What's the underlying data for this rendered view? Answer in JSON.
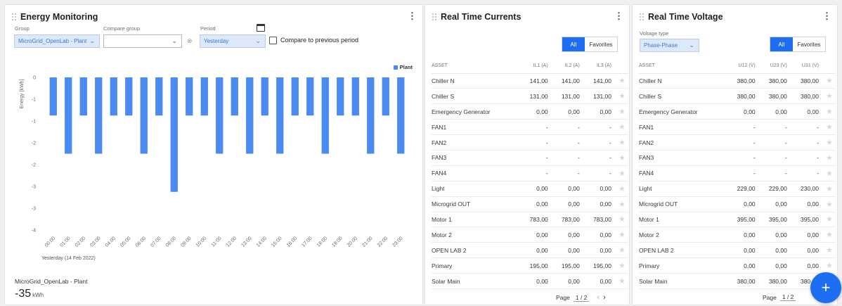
{
  "energy": {
    "title": "Energy Monitoring",
    "group_label": "Group",
    "group_value": "MicroGrid_OpenLab - Plant",
    "compare_label": "Compare group",
    "compare_value": "",
    "period_label": "Period",
    "period_value": "Yesterday",
    "compare_prev_label": "Compare to previous period",
    "x_sublabel": "Yesterday (14 Feb 2022)",
    "summary_name": "MicroGrid_OpenLab - Plant",
    "summary_value": "-35",
    "summary_unit": "kWh"
  },
  "chart_data": {
    "type": "bar",
    "categories": [
      "00:00",
      "01:00",
      "02:00",
      "03:00",
      "04:00",
      "05:00",
      "06:00",
      "07:00",
      "08:00",
      "09:00",
      "10:00",
      "11:00",
      "12:00",
      "13:00",
      "14:00",
      "15:00",
      "16:00",
      "17:00",
      "18:00",
      "19:00",
      "20:00",
      "21:00",
      "22:00",
      "23:00"
    ],
    "series": [
      {
        "name": "Plant",
        "values": [
          -1,
          -2,
          -1,
          -2,
          -1,
          -1,
          -2,
          -1,
          -3,
          -1,
          -1,
          -2,
          -1,
          -2,
          -1,
          -2,
          -1,
          -1,
          -2,
          -1,
          -1,
          -2,
          -1,
          -2
        ]
      }
    ],
    "ylabel": "Energy [kWh]",
    "ylim": [
      -4,
      0
    ],
    "yticks": [
      "0",
      "-1",
      "-1",
      "-2",
      "-2",
      "-3",
      "-3",
      "-4"
    ],
    "color": "#4b8bf0",
    "legend_position": "top-right",
    "grid": false
  },
  "currents": {
    "title": "Real Time Currents",
    "seg_all": "All",
    "seg_fav": "Favorites",
    "headers": [
      "ASSET",
      "IL1 (A)",
      "IL2 (A)",
      "IL3 (A)"
    ],
    "rows": [
      [
        "Chiller N",
        "141,00",
        "141,00",
        "141,00"
      ],
      [
        "Chiller S",
        "131,00",
        "131,00",
        "131,00"
      ],
      [
        "Emergency Generator",
        "0,00",
        "0,00",
        "0,00"
      ],
      [
        "FAN1",
        "-",
        "-",
        "-"
      ],
      [
        "FAN2",
        "-",
        "-",
        "-"
      ],
      [
        "FAN3",
        "-",
        "-",
        "-"
      ],
      [
        "FAN4",
        "-",
        "-",
        "-"
      ],
      [
        "Light",
        "0,00",
        "0,00",
        "0,00"
      ],
      [
        "Microgrid OUT",
        "0,00",
        "0,00",
        "0,00"
      ],
      [
        "Motor 1",
        "783,00",
        "783,00",
        "783,00"
      ],
      [
        "Motor 2",
        "0,00",
        "0,00",
        "0,00"
      ],
      [
        "OPEN LAB 2",
        "0,00",
        "0,00",
        "0,00"
      ],
      [
        "Primary",
        "195,00",
        "195,00",
        "195,00"
      ],
      [
        "Solar Main",
        "0,00",
        "0,00",
        "0,00"
      ]
    ],
    "page_label": "Page",
    "page_value": "1 / 2"
  },
  "voltage": {
    "title": "Real Time Voltage",
    "type_label": "Voltage type",
    "type_value": "Phase-Phase",
    "seg_all": "All",
    "seg_fav": "Favorites",
    "headers": [
      "ASSET",
      "U12 (V)",
      "U23 (V)",
      "U31 (V)"
    ],
    "rows": [
      [
        "Chiller N",
        "380,00",
        "380,00",
        "380,00"
      ],
      [
        "Chiller S",
        "380,00",
        "380,00",
        "380,00"
      ],
      [
        "Emergency Generator",
        "0,00",
        "0,00",
        "0,00"
      ],
      [
        "FAN1",
        "-",
        "-",
        "-"
      ],
      [
        "FAN2",
        "-",
        "-",
        "-"
      ],
      [
        "FAN3",
        "-",
        "-",
        "-"
      ],
      [
        "FAN4",
        "-",
        "-",
        "-"
      ],
      [
        "Light",
        "229,00",
        "229,00",
        "230,00"
      ],
      [
        "Microgrid OUT",
        "0,00",
        "0,00",
        "0,00"
      ],
      [
        "Motor 1",
        "395,00",
        "395,00",
        "395,00"
      ],
      [
        "Motor 2",
        "0,00",
        "0,00",
        "0,00"
      ],
      [
        "OPEN LAB 2",
        "0,00",
        "0,00",
        "0,00"
      ],
      [
        "Primary",
        "0,00",
        "0,00",
        "0,00"
      ],
      [
        "Solar Main",
        "380,00",
        "380,00",
        "380,00"
      ]
    ],
    "page_label": "Page",
    "page_value": "1 / 2"
  },
  "fab_label": "+",
  "icons": {
    "star": "★",
    "kebab": "⋮",
    "chevron": "⌄",
    "clear": "⊗",
    "prev": "‹",
    "next": "›"
  }
}
